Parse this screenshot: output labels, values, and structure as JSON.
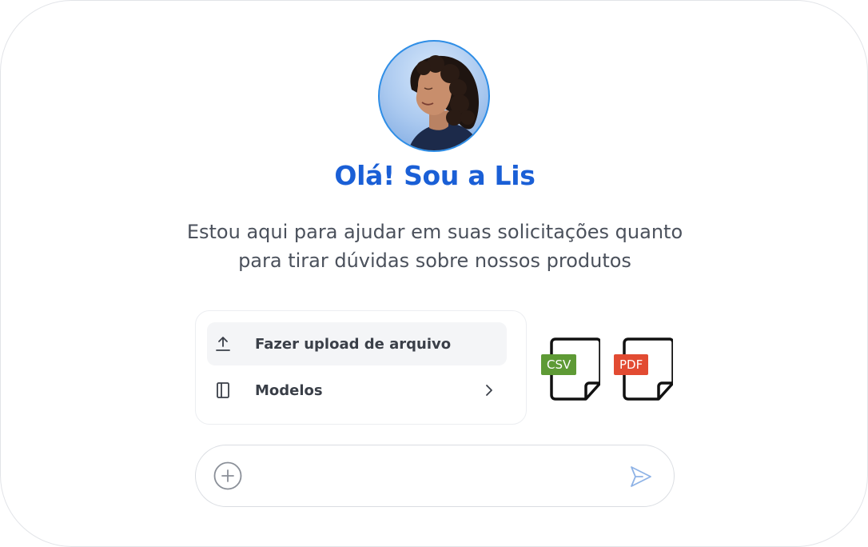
{
  "assistant": {
    "greeting": "Olá! Sou a Lis",
    "subtitle_line1": "Estou aqui para ajudar em suas solicitações quanto",
    "subtitle_line2": "para tirar dúvidas sobre nossos produtos"
  },
  "menu": {
    "items": [
      {
        "label": "Fazer upload de arquivo",
        "icon": "upload-icon"
      },
      {
        "label": "Modelos",
        "icon": "panel-icon",
        "trailing_icon": "chevron-right-icon"
      }
    ]
  },
  "files": [
    {
      "tag": "CSV",
      "color": "#5e9a35"
    },
    {
      "tag": "PDF",
      "color": "#e24b32"
    }
  ],
  "composer": {
    "placeholder": "",
    "add_icon": "plus-circle-icon",
    "send_icon": "send-icon"
  },
  "colors": {
    "accent": "#1a5fd6",
    "avatar_border": "#2f8ee6",
    "send": "#8fb3e6"
  }
}
